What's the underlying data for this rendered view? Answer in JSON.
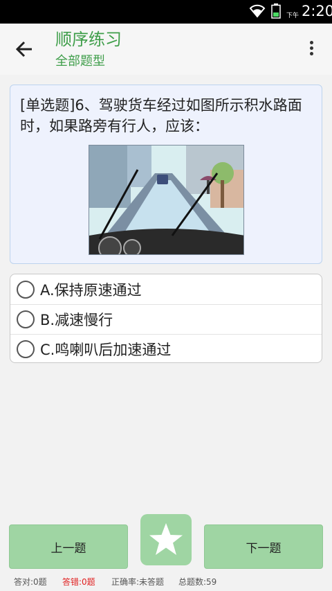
{
  "status_bar": {
    "ampm": "下午",
    "time": "2:20",
    "icons": [
      "wifi-icon",
      "battery-icon"
    ]
  },
  "header": {
    "title": "顺序练习",
    "subtitle": "全部题型",
    "back_icon": "back-arrow-icon",
    "more_icon": "more-vertical-icon",
    "accent_color": "#3f9e4a"
  },
  "question": {
    "text": "[单选题]6、驾驶货车经过如图所示积水路面时，如果路旁有行人，应该：",
    "image": "flooded-road-illustration"
  },
  "options": [
    {
      "label": "A.保持原速通过",
      "selected": false
    },
    {
      "label": "B.减速慢行",
      "selected": false
    },
    {
      "label": "C.鸣喇叭后加速通过",
      "selected": false
    }
  ],
  "navigation": {
    "prev_label": "上一题",
    "next_label": "下一题",
    "favorite_icon": "star-icon",
    "button_color": "#9fd5a3"
  },
  "stats": {
    "correct": "答对:0题",
    "wrong": "答错:0题",
    "accuracy": "正确率:未答题",
    "total": "总题数:59",
    "wrong_color": "#e02020"
  }
}
